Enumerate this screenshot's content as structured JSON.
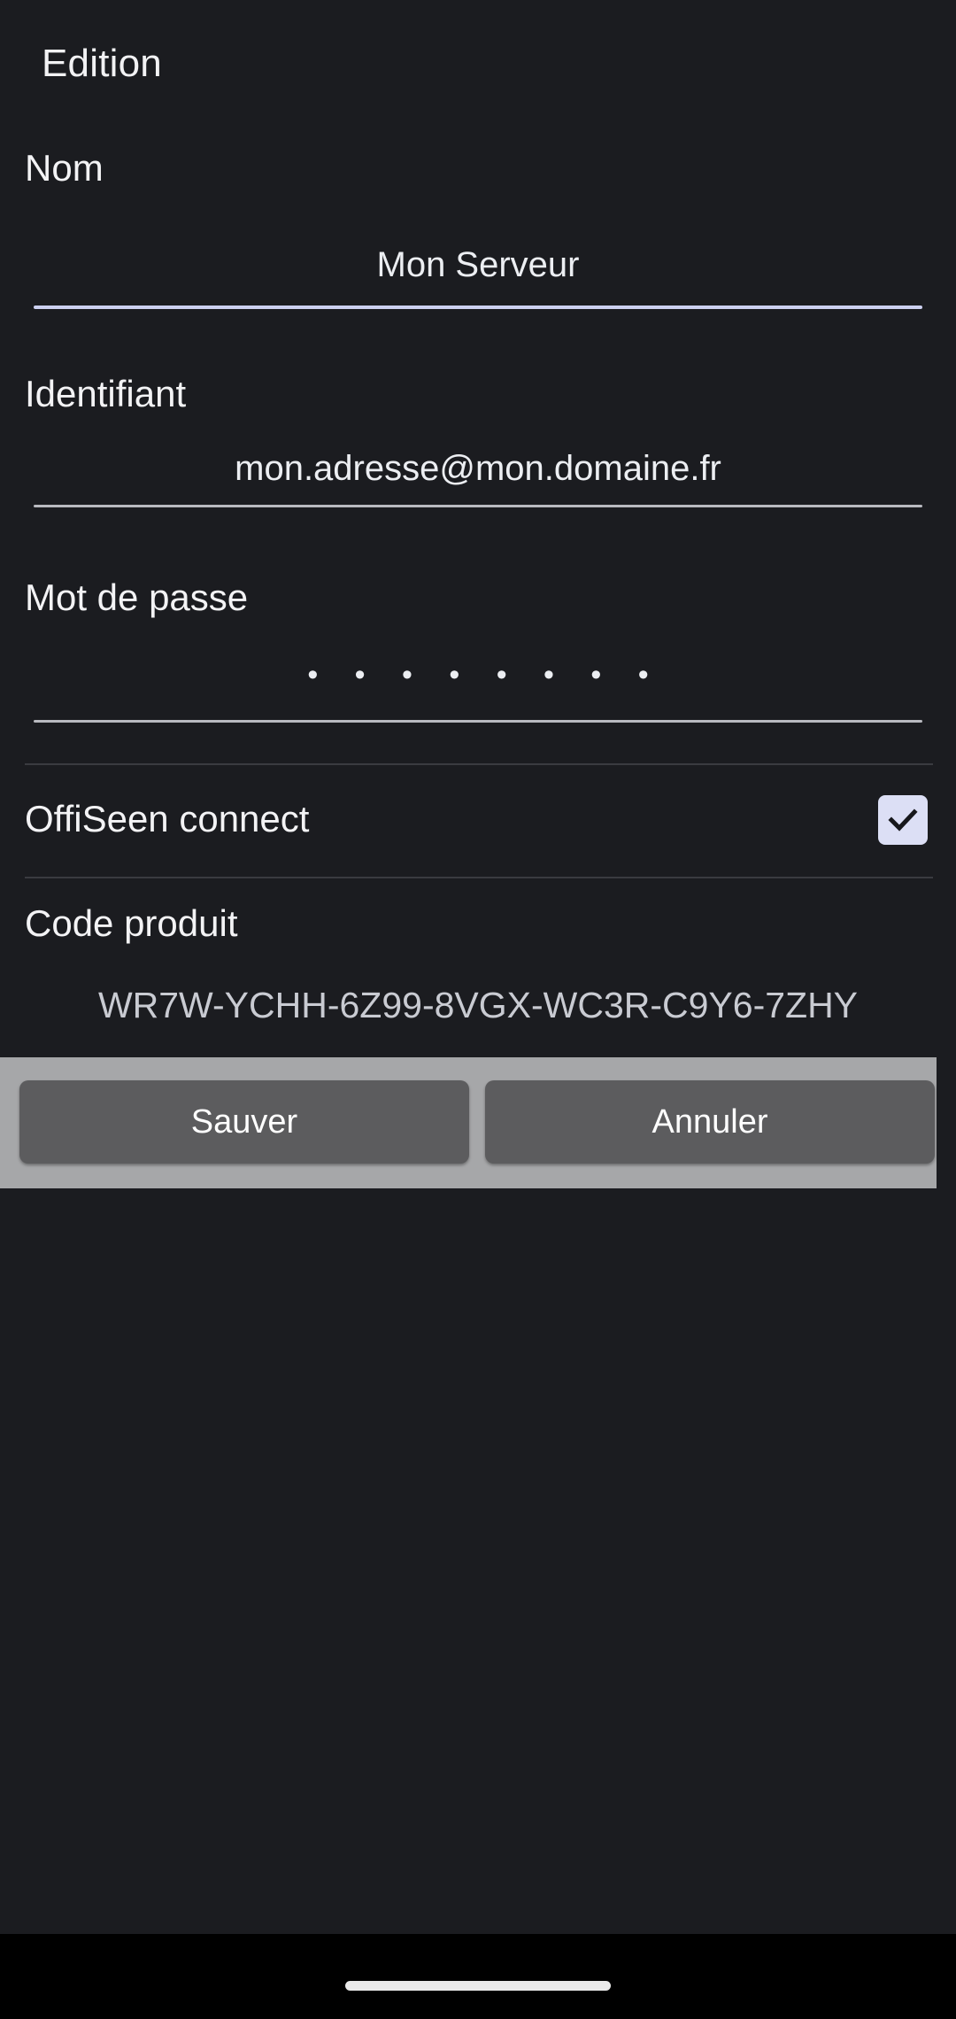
{
  "screen": {
    "title": "Edition",
    "background_color": "#1b1c20"
  },
  "form": {
    "fields": [
      {
        "label": "Nom",
        "value": "Mon Serveur",
        "type": "text",
        "focused": true,
        "underline_color": "#ccd0f0"
      },
      {
        "label": "Identifiant",
        "value": "mon.adresse@mon.domaine.fr",
        "type": "text",
        "focused": false,
        "underline_color": "#b9bac0"
      },
      {
        "label": "Mot de passe",
        "value": "• • • • • • • •",
        "type": "password",
        "focused": false,
        "underline_color": "#b9bac0"
      }
    ],
    "toggle": {
      "label": "OffiSeen connect",
      "checked": true,
      "checkbox_fill": "#dcdff5",
      "check_color": "#17181c",
      "icon": "check-icon"
    },
    "product_code": {
      "label": "Code produit",
      "value": "WR7W-YCHH-6Z99-8VGX-WC3R-C9Y6-7ZHY"
    }
  },
  "actions": {
    "save_label": "Sauver",
    "cancel_label": "Annuler",
    "bar_color": "#a6a7a9",
    "button_color": "#5c5c5e"
  },
  "system": {
    "nav_bar": "gesture-pill"
  }
}
